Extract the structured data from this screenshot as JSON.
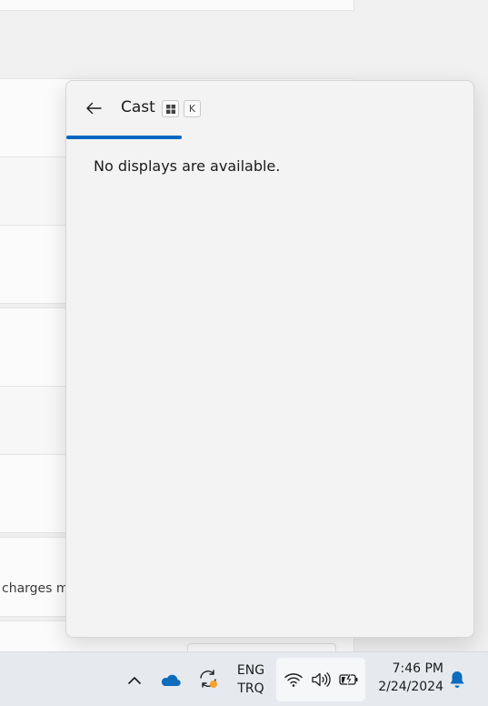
{
  "background_window": {
    "partial_text": "charges ma"
  },
  "cast_flyout": {
    "title": "Cast",
    "shortcut_keys": [
      "win-key-icon",
      "K"
    ],
    "status_message": "No displays are available.",
    "progress_color": "#0067c0"
  },
  "taskbar": {
    "icons": [
      "chevron-up-icon",
      "onedrive-icon",
      "sync-icon",
      "wifi-icon",
      "volume-icon",
      "battery-charging-icon",
      "notification-bell-icon"
    ],
    "language_line1": "ENG",
    "language_line2": "TRQ",
    "time": "7:46 PM",
    "date": "2/24/2024"
  }
}
